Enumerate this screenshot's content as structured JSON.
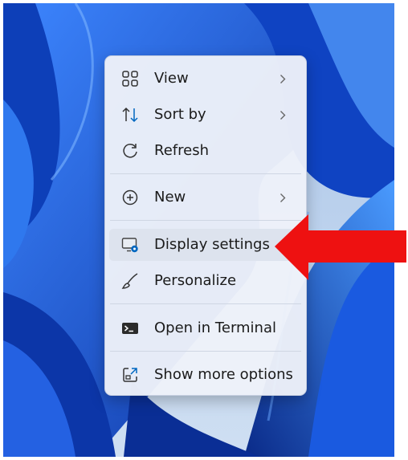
{
  "menu": {
    "items": [
      {
        "label": "View",
        "icon": "grid-icon",
        "submenu": true
      },
      {
        "label": "Sort by",
        "icon": "sort-icon",
        "submenu": true
      },
      {
        "label": "Refresh",
        "icon": "refresh-icon",
        "submenu": false
      },
      {
        "label": "New",
        "icon": "plus-circle-icon",
        "submenu": true
      },
      {
        "label": "Display settings",
        "icon": "display-settings-icon",
        "submenu": false,
        "highlighted": true
      },
      {
        "label": "Personalize",
        "icon": "brush-icon",
        "submenu": false
      },
      {
        "label": "Open in Terminal",
        "icon": "terminal-icon",
        "submenu": false
      },
      {
        "label": "Show more options",
        "icon": "expand-icon",
        "submenu": false
      }
    ]
  },
  "annotation": {
    "arrow_color": "#ee1111",
    "arrow_target": "Display settings"
  },
  "colors": {
    "accent": "#0067c0",
    "wallpaper": "#1656d6",
    "menu_background": "#eef1f9"
  }
}
